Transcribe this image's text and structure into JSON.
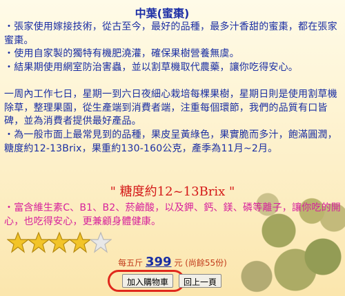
{
  "product": {
    "title": "中葉(蜜棗)",
    "paragraphs": [
      "・張家使用嫁接技術，從古至今，最好的品種，最多汁香甜的蜜棗，都在張家蜜棗。",
      "・使用自家製的獨特有機肥澆灌，確保果樹營養無虞。",
      "・結果期使用網室防治害蟲，並以割草機取代農藥，讓你吃得安心。",
      "一周內工作七日，星期一到六日夜細心栽培每棵果樹，星期日則是使用割草機除草，整理果園，從生產端到消費者端，注重每個環節，我們的品質有口皆碑，並為消費者提供最好產品。",
      "・為一般市面上最常見到的品種，果皮呈黃綠色，果實脆而多汁，飽滿圓潤，糖度約12-13Brix，果重約130-160公克，產季為11月~2月。"
    ],
    "brix_highlight": "\" 糖度約12~13Brix \"",
    "nutrition": "・富含維生素C、B1、B2、菸鹼酸，以及鉀、鈣、鎂、磷等離子，讓你吃的開心，也吃得安心，更兼顧身體健康。",
    "rating": 4,
    "rating_max": 5,
    "price_prefix": "每五斤",
    "price": "399",
    "price_suffix": "元 (尚餘55份)"
  },
  "buttons": {
    "add_to_cart": "加入購物車",
    "back": "回上一頁"
  },
  "colors": {
    "title": "#1d2fa6",
    "body_text": "#1a2ea3",
    "highlight": "#d41818",
    "nutrition": "#d6219c",
    "star_filled": "#f2c428",
    "star_empty": "#e8e8e8",
    "callout": "#e0281c"
  }
}
